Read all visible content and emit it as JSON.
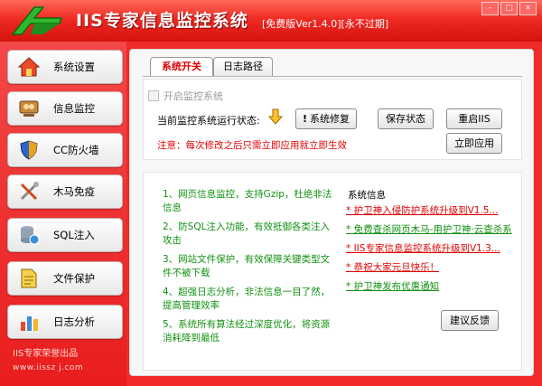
{
  "titlebar": {
    "title": "IIS专家信息监控系统",
    "edition": "[免费版Ver1.4.0][永不过期]",
    "buttons": {
      "minimize": "-",
      "maximize": "□",
      "close": "×"
    }
  },
  "sidebar": {
    "items": [
      {
        "label": "系统设置",
        "icon": "house-icon"
      },
      {
        "label": "信息监控",
        "icon": "monitor-people-icon"
      },
      {
        "label": "CC防火墙",
        "icon": "shield-icon"
      },
      {
        "label": "木马免疫",
        "icon": "tools-icon"
      },
      {
        "label": "SQL注入",
        "icon": "database-icon"
      },
      {
        "label": "文件保护",
        "icon": "document-icon"
      },
      {
        "label": "日志分析",
        "icon": "chart-icon"
      }
    ],
    "brand": "IIS专家荣誉出品",
    "url": "www.iissz j.com"
  },
  "tabs": [
    {
      "label": "系统开关",
      "active": true
    },
    {
      "label": "日志路径",
      "active": false
    }
  ],
  "settings": {
    "enable_label": "开启监控系统",
    "status_label": "当前监控系统运行状态:",
    "repair_label": "系统修复",
    "save_label": "保存状态",
    "restart_label": "重启IIS",
    "apply_label": "立即应用",
    "notice": "注意：每次修改之后只需立即应用就立即生效"
  },
  "tips": [
    "1、网页信息监控，支持Gzip，杜绝非法信息",
    "2、防SQL注入功能，有效抵御各类注入攻击",
    "3、网站文件保护，有效保障关键类型文件不被下载",
    "4、超强日志分析，非法信息一目了然，提高管理效率",
    "5、系统所有算法经过深度优化，将资源消耗降到最低"
  ],
  "system_info": {
    "title": "系统信息",
    "news": [
      {
        "text": "* 护卫神入侵防护系统升级到V1.5...",
        "color": "red"
      },
      {
        "text": "* 免费查杀网页木马-用护卫神·云查杀系",
        "color": "green"
      },
      {
        "text": "* IIS专家信息监控系统升级到V1.3...",
        "color": "red"
      },
      {
        "text": "* 恭祝大家元旦快乐！",
        "color": "red"
      },
      {
        "text": "* 护卫神发布优惠通知",
        "color": "green"
      }
    ],
    "feedback_label": "建议反馈"
  },
  "colors": {
    "frame": "#f12a2a",
    "accent_red": "#e00000",
    "tip_green": "#129112"
  }
}
